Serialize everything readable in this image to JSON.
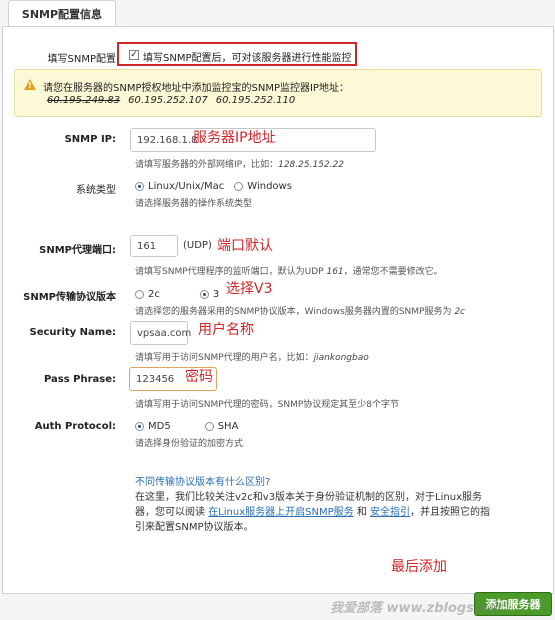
{
  "tab_title": "SNMP配置信息",
  "enable": {
    "label": "填写SNMP配置",
    "checkbox_text": "填写SNMP配置后，可对该服务器进行性能监控",
    "checked": true
  },
  "warning": {
    "text": "请您在服务器的SNMP授权地址中添加监控宝的SNMP监控器IP地址：",
    "ip_struck": "60.195.249.83",
    "ip1": "60.195.252.107",
    "ip2": "60.195.252.110"
  },
  "snmp_ip": {
    "label": "SNMP IP:",
    "value": "192.168.1.8",
    "annotation": "服务器IP地址",
    "hint": "请填写服务器的外部网络IP，比如：",
    "hint_example": "128.25.152.22"
  },
  "os_type": {
    "label": "系统类型",
    "options": [
      "Linux/Unix/Mac",
      "Windows"
    ],
    "selected": "Linux/Unix/Mac",
    "hint": "请选择服务器的操作系统类型"
  },
  "port": {
    "label": "SNMP代理端口:",
    "value": "161",
    "unit": "(UDP)",
    "annotation": "端口默认",
    "hint": "请填写SNMP代理程序的监听端口，默认为UDP",
    "hint_example": "161",
    "hint_tail": "，通常您不需要修改它。"
  },
  "version": {
    "label": "SNMP传输协议版本",
    "options": [
      "2c",
      "3"
    ],
    "selected": "3",
    "annotation": "选择V3",
    "hint": "请选择您的服务器采用的SNMP协议版本，Windows服务器内置的SNMP服务为",
    "hint_example": "2c"
  },
  "security_name": {
    "label": "Security Name:",
    "value": "vpsaa.com",
    "annotation": "用户名称",
    "hint": "请填写用于访问SNMP代理的用户名，比如：",
    "hint_example": "jiankongbao"
  },
  "pass_phrase": {
    "label": "Pass Phrase:",
    "value": "123456",
    "annotation": "密码",
    "hint": "请填写用于访问SNMP代理的密码，SNMP协议规定其至少8个字节"
  },
  "auth_protocol": {
    "label": "Auth Protocol:",
    "options": [
      "MD5",
      "SHA"
    ],
    "selected": "MD5",
    "hint": "请选择身份验证的加密方式"
  },
  "info": {
    "link_title": "不同传输协议版本有什么区别?",
    "p1": "在这里，我们比较关注v2c和v3版本关于身份验证机制的区别，对于Linux服务",
    "p2a": "器，您可以阅读",
    "link1": "在Linux服务器上开启SNMP服务",
    "p2b": "和",
    "link2": "安全指引",
    "p2c": "，并且按照它的指",
    "p3": "引来配置SNMP协议版本。"
  },
  "final_annotation": "最后添加",
  "submit_label": "添加服务器",
  "watermark": "我爱部落 www.zblogs.net",
  "colors": {
    "annotation_red": "#d0262a",
    "link_blue": "#2a6fb5",
    "button_green": "#4c9a2a",
    "warning_bg": "#fdf9d6"
  }
}
